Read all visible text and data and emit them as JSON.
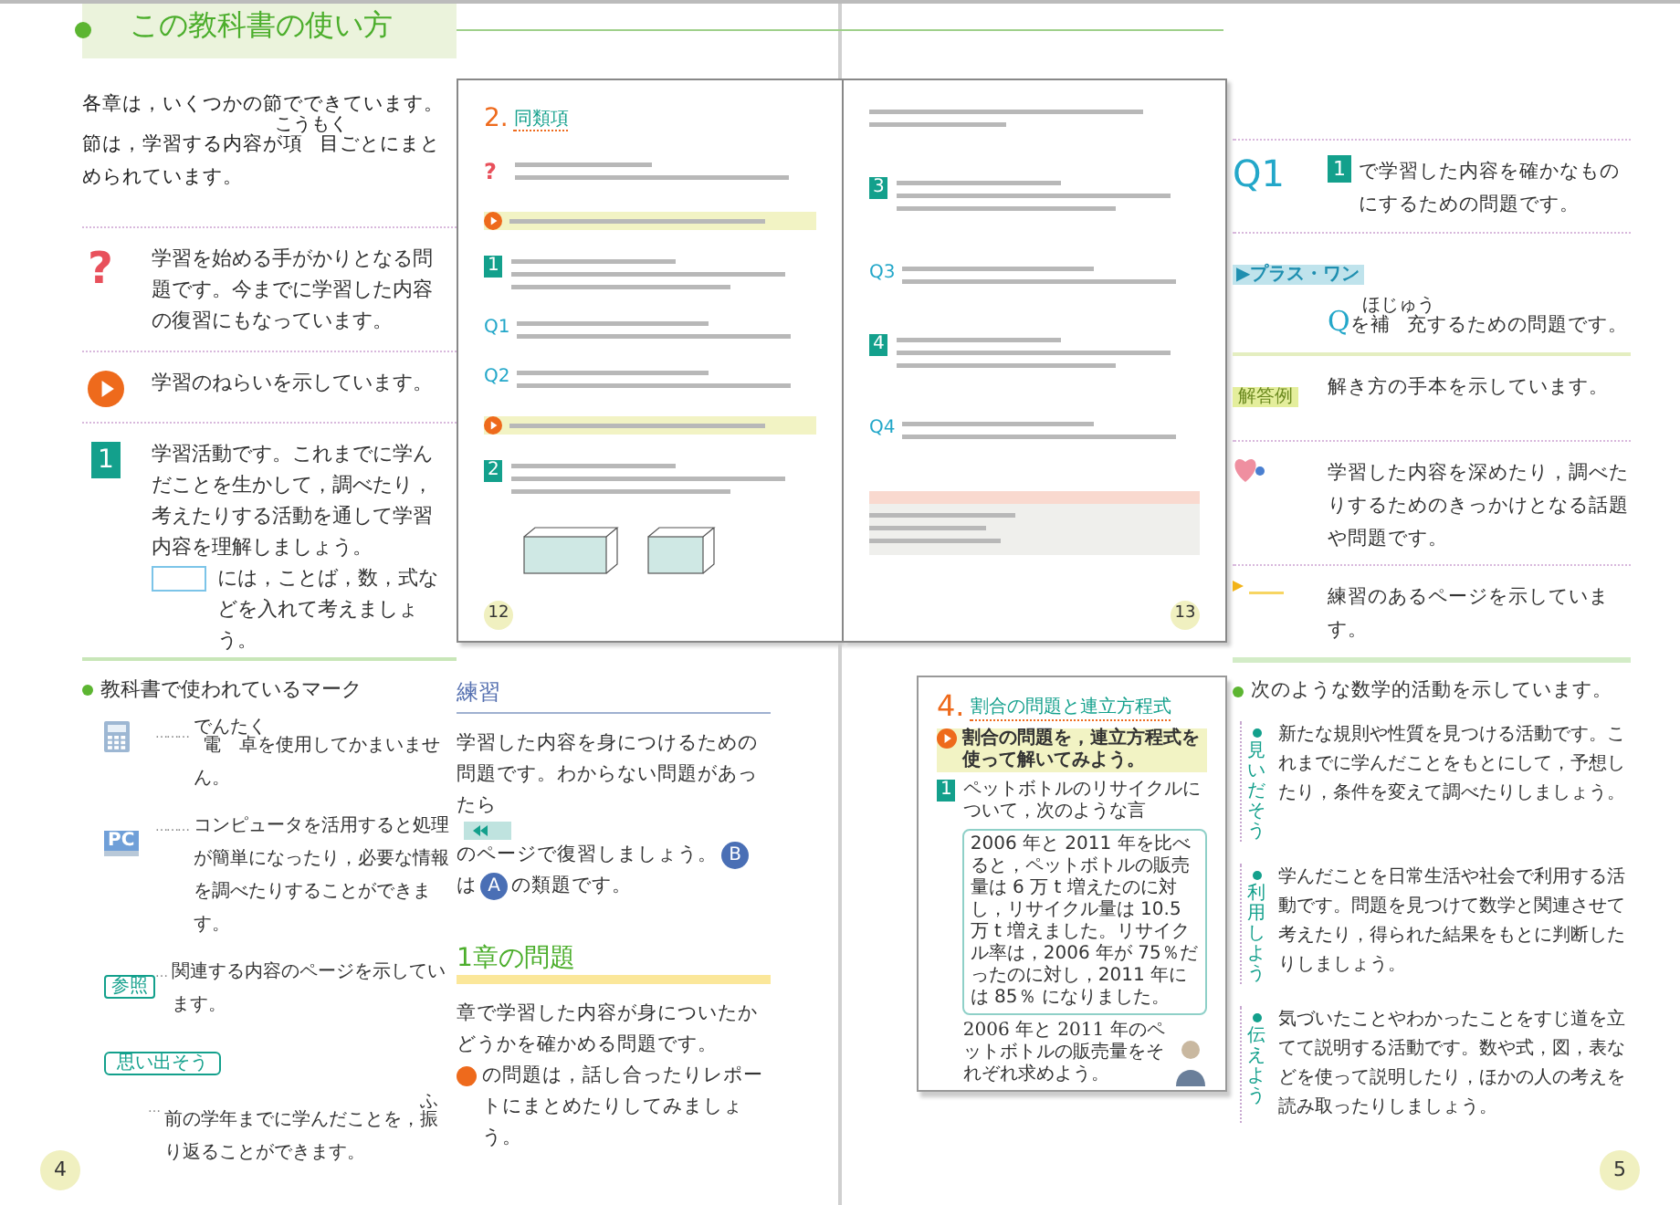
{
  "header": {
    "title": "この教科書の使い方"
  },
  "intro": [
    {
      "text": "各章は，いくつかの節でできています。節は，学習する内容が"
    },
    {
      "text": "項目",
      "ruby": "こうもく"
    },
    {
      "text": "ごとにまとめられています。"
    }
  ],
  "left_marks": [
    {
      "kind": "question",
      "glyph": "?",
      "paragraphs": [
        [
          {
            "text": "学習を始める手がかりとなる問題です。今までに学習した内容の復習にもなっています。"
          }
        ]
      ]
    },
    {
      "kind": "aim",
      "paragraphs": [
        [
          {
            "text": "学習のねらいを示しています。"
          }
        ]
      ]
    },
    {
      "kind": "step",
      "label": "1",
      "paragraphs": [
        [
          {
            "text": "学習活動です。これまでに学んだことを生かして，調べたり，考えたりする活動を通して学習内容を理解しましょう。"
          }
        ],
        [
          {
            "kind": "blank"
          },
          {
            "text": "には，ことば，数，式などを入れて考えましょう。"
          }
        ]
      ]
    }
  ],
  "spread": [
    {
      "number": "12",
      "blocks": [
        {
          "kind": "heading",
          "label": "2.",
          "text": "同類項"
        },
        {
          "kind": "question",
          "label": "?"
        },
        {
          "kind": "aim"
        },
        {
          "kind": "step",
          "label": "1"
        },
        {
          "kind": "q",
          "label": "Q1"
        },
        {
          "kind": "q",
          "label": "Q2"
        },
        {
          "kind": "aim"
        },
        {
          "kind": "step",
          "label": "2"
        },
        {
          "kind": "figure"
        }
      ]
    },
    {
      "number": "13",
      "blocks": [
        {
          "kind": "text"
        },
        {
          "kind": "step",
          "label": "3"
        },
        {
          "kind": "q",
          "label": "Q3"
        },
        {
          "kind": "step",
          "label": "4"
        },
        {
          "kind": "q",
          "label": "Q4"
        },
        {
          "kind": "callout"
        }
      ]
    }
  ],
  "textbook_marks": {
    "heading": "教科書で使われているマーク",
    "items": [
      {
        "kind": "calculator",
        "leader": "………",
        "segments": [
          {
            "text": "電卓",
            "ruby": "でんたく"
          },
          {
            "text": "を使用してかまいません。"
          }
        ]
      },
      {
        "kind": "pc",
        "label": "PC",
        "leader": "………",
        "segments": [
          {
            "text": "コンピュータを活用すると処理が簡単になったり，必要な情報を調べたりすることができます。"
          }
        ]
      },
      {
        "kind": "reference",
        "label": "参照",
        "leader": "…",
        "segments": [
          {
            "text": "関連する内容のページを示しています。"
          }
        ]
      },
      {
        "kind": "recall",
        "label": "思い出そう",
        "leader": "…",
        "segments": [
          {
            "text": "前の学年までに学んだことを，"
          },
          {
            "text": "振",
            "ruby": "ふ"
          },
          {
            "text": "り返ることができます。"
          }
        ]
      }
    ]
  },
  "practice": {
    "title": "練習",
    "segments": [
      {
        "text": "学習した内容を身につけるための問題です。わからない問題があったら"
      },
      {
        "kind": "rewind"
      },
      {
        "text": "のページで復習しましょう。"
      },
      {
        "kind": "circle",
        "text": "B"
      },
      {
        "text": "は"
      },
      {
        "kind": "circle",
        "text": "A"
      },
      {
        "text": "の類題です。"
      }
    ]
  },
  "chapter_problems": {
    "title": "1章の問題",
    "paragraphs": [
      [
        {
          "text": "章で学習した内容が身についたかどうかを確かめる問題です。"
        }
      ],
      [
        {
          "kind": "dot"
        },
        {
          "text": "の問題は，話し合ったりレポートにまとめたりしてみましょう。"
        }
      ]
    ]
  },
  "preview": {
    "number": "4.",
    "title": "割合の問題と連立方程式",
    "aim": "割合の問題を，連立方程式を使って解いてみよう。",
    "step": "1",
    "intro": "ペットボトルのリサイクルについて，次のような言",
    "box": "2006 年と 2011 年を比べると，ペットボトルの販売量は 6 万 t 増えたのに対し，リサイクル量は 10.5 万 t 増えました。リサイクル率は，2006 年が 75％だったのに対し，2011 年には 85％ になりました。",
    "task": "2006 年と 2011 年のペットボトルの販売量をそれぞれ求めよう。"
  },
  "right_marks": [
    {
      "kind": "q",
      "label": "Q1",
      "segments": [
        {
          "kind": "number",
          "text": "1"
        },
        {
          "text": "で学習した内容を確かなものにするための問題です。"
        }
      ]
    },
    {
      "kind": "plus",
      "label": "▶プラス・ワン",
      "segments": [
        {
          "kind": "accent",
          "text": "Q"
        },
        {
          "text": "を"
        },
        {
          "text": "補充",
          "ruby": "ほじゅう"
        },
        {
          "text": "するための問題です。"
        }
      ]
    },
    {
      "kind": "answer",
      "label": "解答例",
      "segments": [
        {
          "text": "解き方の手本を示しています。"
        }
      ]
    },
    {
      "kind": "heart",
      "segments": [
        {
          "text": "学習した内容を深めたり，調べたりするためのきっかけとなる話題や問題です。"
        }
      ]
    },
    {
      "kind": "practice",
      "segments": [
        {
          "text": "練習のあるページを示しています。"
        }
      ]
    }
  ],
  "activities": {
    "heading": "次のような数学的活動を示しています。",
    "items": [
      {
        "label": "見いだそう",
        "text": "新たな規則や性質を見つける活動です。これまでに学んだことをもとにして，予想したり，条件を変えて調べたりしましょう。"
      },
      {
        "label": "利用しよう",
        "text": "学んだことを日常生活や社会で利用する活動です。問題を見つけて数学と関連させて考えたり，得られた結果をもとに判断したりしましょう。"
      },
      {
        "label": "伝えよう",
        "text": "気づいたことやわかったことをすじ道を立てて説明する活動です。数や式，図，表などを使って説明したり，ほかの人の考えを読み取ったりしましょう。"
      }
    ]
  },
  "page_numbers": [
    "4",
    "5"
  ]
}
